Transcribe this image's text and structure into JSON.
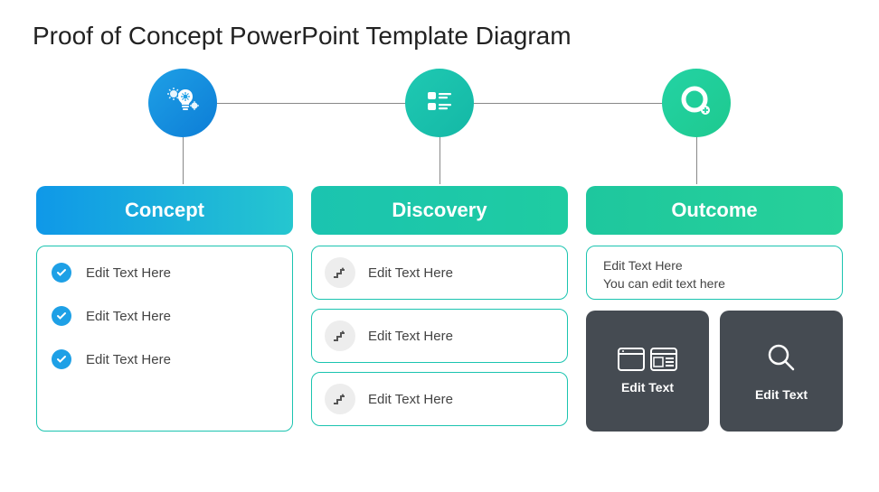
{
  "title": "Proof of Concept PowerPoint Template Diagram",
  "columns": {
    "concept": {
      "header": "Concept",
      "items": [
        "Edit Text Here",
        "Edit Text Here",
        "Edit Text Here"
      ]
    },
    "discovery": {
      "header": "Discovery",
      "items": [
        "Edit Text Here",
        "Edit Text Here",
        "Edit Text Here"
      ]
    },
    "outcome": {
      "header": "Outcome",
      "top_line1": "Edit Text Here",
      "top_line2": "You can edit text here",
      "cards": [
        "Edit Text",
        "Edit Text"
      ]
    }
  }
}
